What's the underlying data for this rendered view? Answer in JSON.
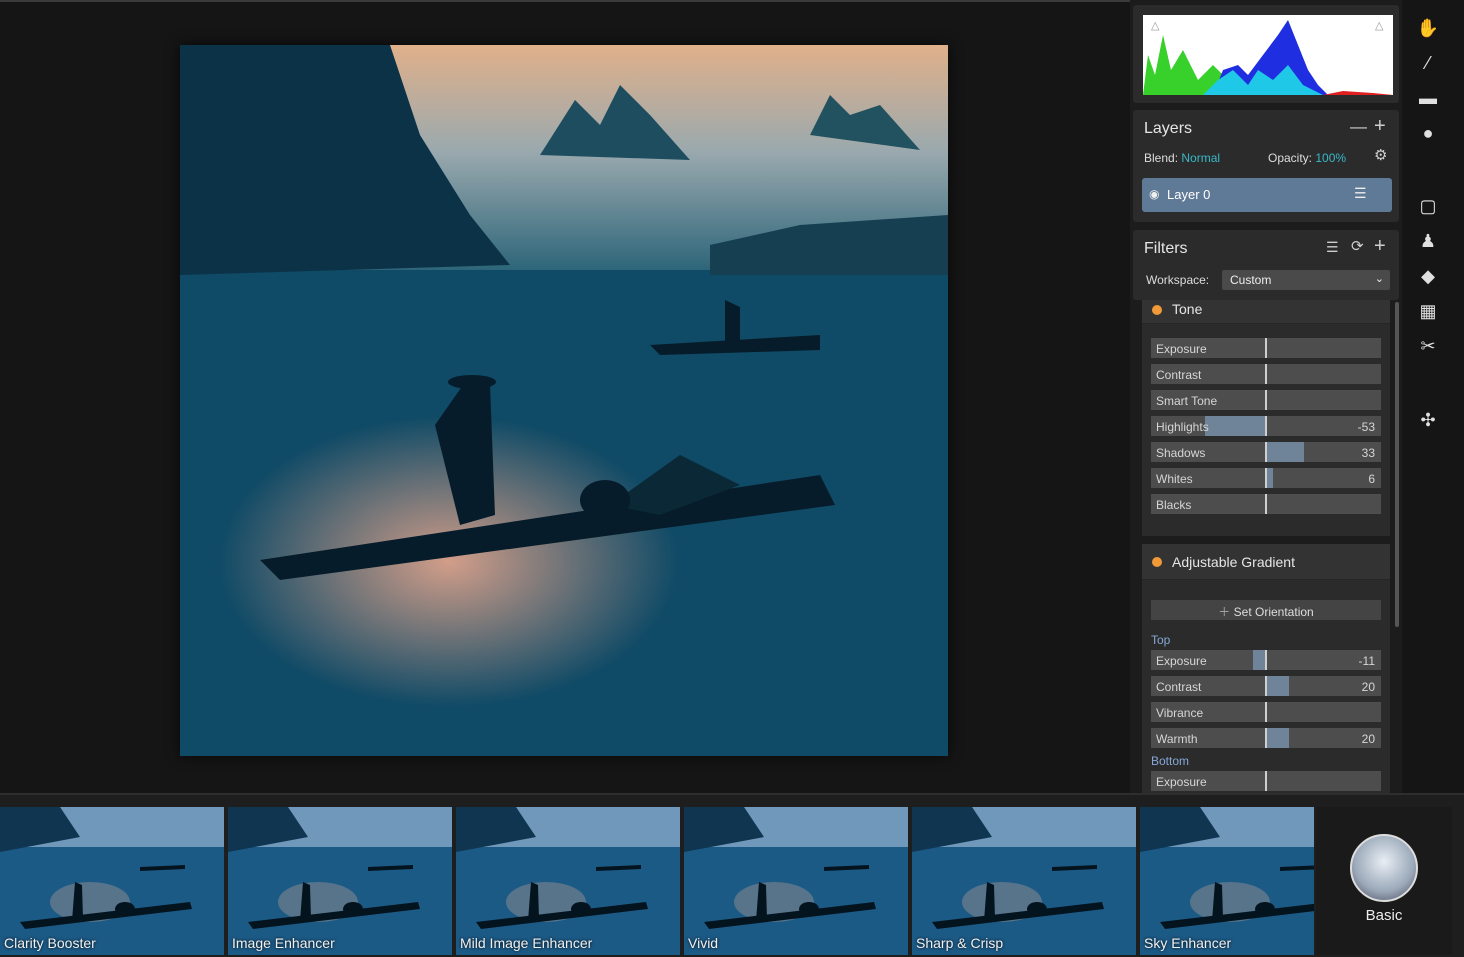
{
  "histogram": {
    "name": "histogram"
  },
  "layers": {
    "title": "Layers",
    "blend_label": "Blend:",
    "blend_value": "Normal",
    "opacity_label": "Opacity:",
    "opacity_value": "100%",
    "layer_name": "Layer 0"
  },
  "filters": {
    "title": "Filters",
    "workspace_label": "Workspace:",
    "workspace_value": "Custom"
  },
  "tone": {
    "name": "Tone",
    "sliders": [
      {
        "label": "Exposure",
        "value": 0,
        "text": ""
      },
      {
        "label": "Contrast",
        "value": 0,
        "text": ""
      },
      {
        "label": "Smart Tone",
        "value": 0,
        "text": ""
      },
      {
        "label": "Highlights",
        "value": -53,
        "text": "-53"
      },
      {
        "label": "Shadows",
        "value": 33,
        "text": "33"
      },
      {
        "label": "Whites",
        "value": 6,
        "text": "6"
      },
      {
        "label": "Blacks",
        "value": 0,
        "text": ""
      }
    ]
  },
  "gradient": {
    "name": "Adjustable Gradient",
    "orient_label": "Set Orientation",
    "top_label": "Top",
    "top_sliders": [
      {
        "label": "Exposure",
        "value": -11,
        "text": "-11"
      },
      {
        "label": "Contrast",
        "value": 20,
        "text": "20"
      },
      {
        "label": "Vibrance",
        "value": 0,
        "text": ""
      },
      {
        "label": "Warmth",
        "value": 20,
        "text": "20"
      }
    ],
    "bottom_label": "Bottom",
    "bottom_sliders": [
      {
        "label": "Exposure",
        "value": 0,
        "text": ""
      }
    ]
  },
  "presets": [
    {
      "label": "Clarity Booster"
    },
    {
      "label": "Image Enhancer"
    },
    {
      "label": "Mild Image Enhancer"
    },
    {
      "label": "Vivid"
    },
    {
      "label": "Sharp & Crisp"
    },
    {
      "label": "Sky Enhancer"
    }
  ],
  "category": {
    "label": "Basic"
  },
  "tools": [
    "hand-icon",
    "brush-icon",
    "gradient-icon",
    "radial-icon",
    "crop-icon",
    "stamp-icon",
    "eraser-icon",
    "mask-icon",
    "scissors-icon",
    "extensions-icon"
  ],
  "colors": {
    "accent": "#39b8c8",
    "layer_selected": "#5f7a96",
    "filter_dot": "#f29a38",
    "slider_fill": "#6f8499"
  }
}
